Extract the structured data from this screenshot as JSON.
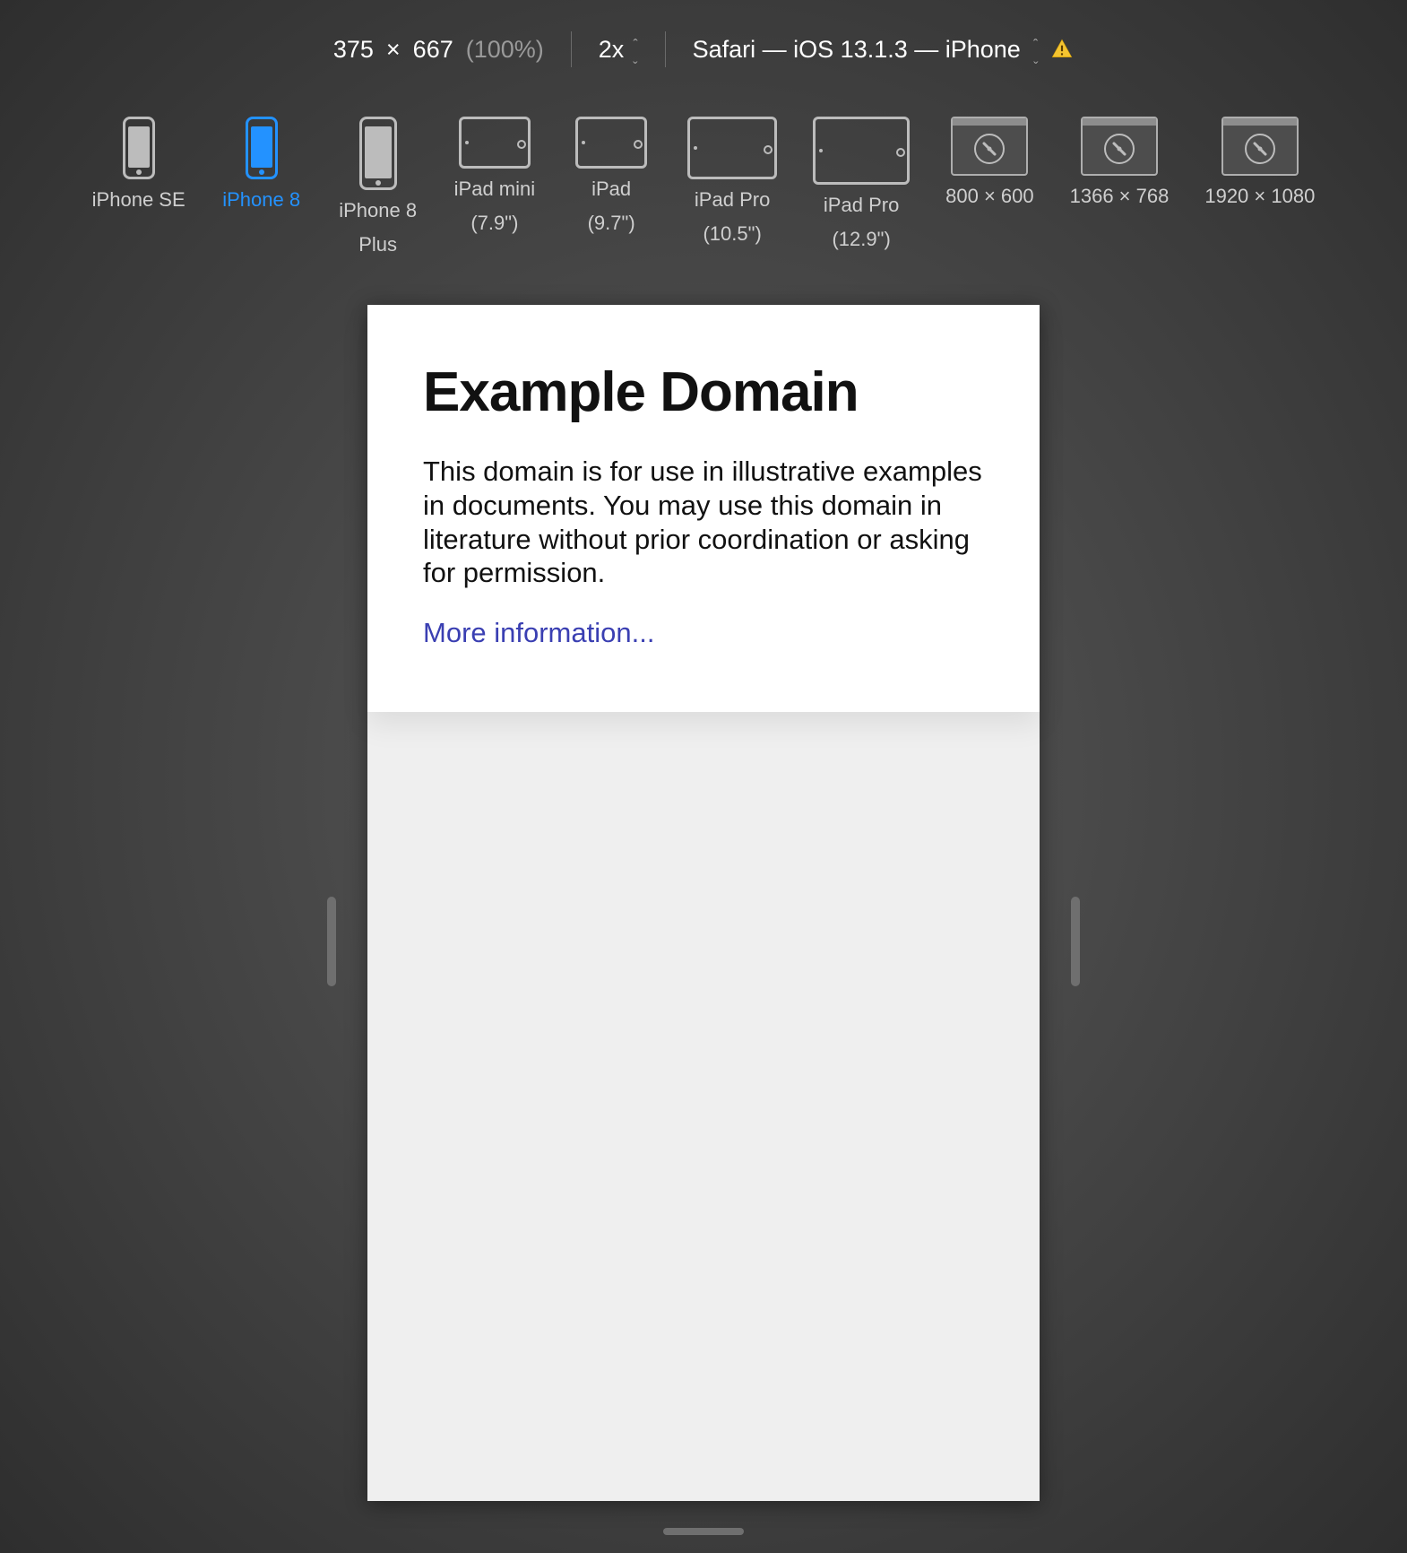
{
  "toolbar": {
    "width": "375",
    "times": "×",
    "height": "667",
    "zoom_pct": "(100%)",
    "pixel_ratio": "2x",
    "user_agent": "Safari — iOS 13.1.3 — iPhone"
  },
  "devices": [
    {
      "label": "iPhone SE",
      "label2": "",
      "type": "phone",
      "size": "",
      "active": false
    },
    {
      "label": "iPhone 8",
      "label2": "",
      "type": "phone",
      "size": "",
      "active": true
    },
    {
      "label": "iPhone 8",
      "label2": "Plus",
      "type": "phone",
      "size": "large",
      "active": false
    },
    {
      "label": "iPad mini",
      "label2": "(7.9\")",
      "type": "tablet",
      "size": "",
      "active": false
    },
    {
      "label": "iPad",
      "label2": "(9.7\")",
      "type": "tablet",
      "size": "",
      "active": false
    },
    {
      "label": "iPad Pro",
      "label2": "(10.5\")",
      "type": "tablet",
      "size": "big",
      "active": false
    },
    {
      "label": "iPad Pro",
      "label2": "(12.9\")",
      "type": "tablet",
      "size": "xl",
      "active": false
    },
    {
      "label": "800 × 600",
      "label2": "",
      "type": "browser",
      "size": "",
      "active": false
    },
    {
      "label": "1366 × 768",
      "label2": "",
      "type": "browser",
      "size": "",
      "active": false
    },
    {
      "label": "1920 × 1080",
      "label2": "",
      "type": "browser",
      "size": "",
      "active": false
    }
  ],
  "page": {
    "heading": "Example Domain",
    "body": "This domain is for use in illustrative examples in documents. You may use this domain in literature without prior coordination or asking for permission.",
    "link": "More information..."
  }
}
